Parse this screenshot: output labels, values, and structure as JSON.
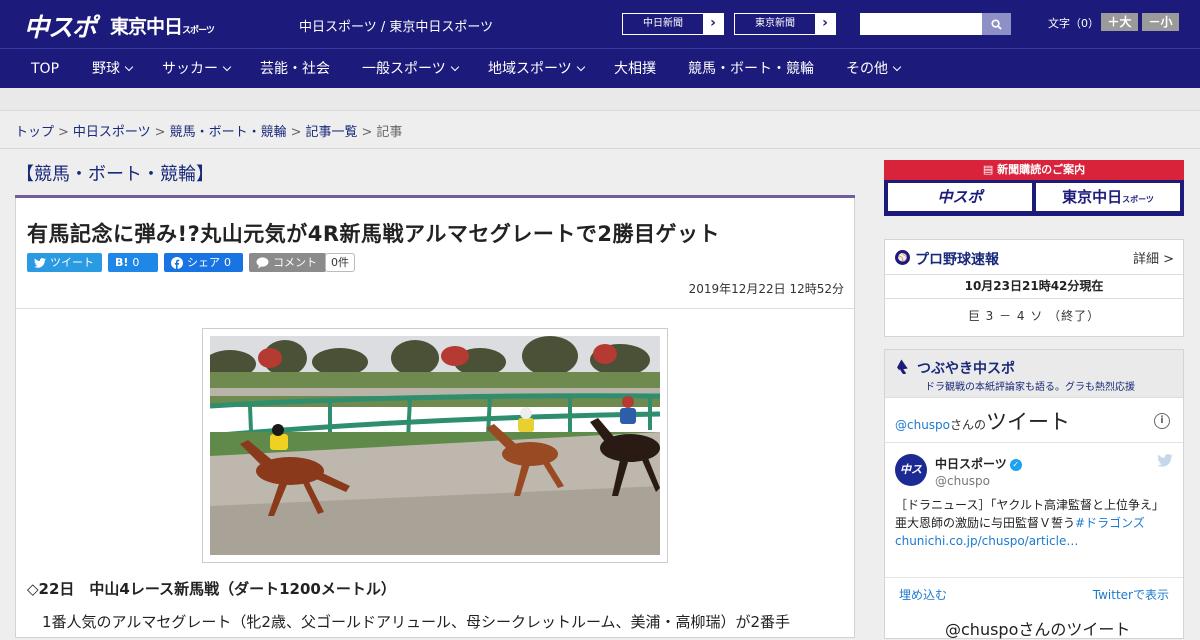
{
  "header": {
    "logo_main": "中スポ",
    "logo_tokyo": "東京中日",
    "logo_tokyo_suffix": "スポーツ",
    "site_links": "中日スポーツ / 東京中日スポーツ",
    "ext_link_1": "中日新聞",
    "ext_link_2": "東京新聞",
    "search_placeholder": "",
    "font_size_label": "文字（0）",
    "font_larger": "＋大",
    "font_smaller": "－小"
  },
  "nav": [
    {
      "label": "TOP",
      "dropdown": false
    },
    {
      "label": "野球",
      "dropdown": true
    },
    {
      "label": "サッカー",
      "dropdown": true
    },
    {
      "label": "芸能・社会",
      "dropdown": false
    },
    {
      "label": "一般スポーツ",
      "dropdown": true
    },
    {
      "label": "地域スポーツ",
      "dropdown": true
    },
    {
      "label": "大相撲",
      "dropdown": false
    },
    {
      "label": "競馬・ボート・競輪",
      "dropdown": false
    },
    {
      "label": "その他",
      "dropdown": true
    }
  ],
  "breadcrumb": [
    "トップ",
    "中日スポーツ",
    "競馬・ボート・競輪",
    "記事一覧",
    "記事"
  ],
  "article": {
    "section": "【競馬・ボート・競輪】",
    "headline": "有馬記念に弾み!?丸山元気が4R新馬戦アルマセグレートで2勝目ゲット",
    "share": {
      "tweet": "ツイート",
      "hatena": "B!",
      "hatena_count": "0",
      "facebook": "シェア",
      "facebook_count": "0",
      "comment": "コメント",
      "comment_count": "0件"
    },
    "date": "2019年12月22日 12時52分",
    "subhead": "◇22日　中山4レース新馬戦（ダート1200メートル）",
    "body": "1番人気のアルマセグレート（牝2歳、父ゴールドアリュール、母シークレットルーム、美浦・高柳瑞）が2番手"
  },
  "sidebar": {
    "ad_title": "新聞購読のご案内",
    "ad_btn_1": "中スポ",
    "ad_btn_2": "東京中日",
    "ad_btn_2_suffix": "スポーツ",
    "baseball": {
      "title": "プロ野球速報",
      "detail": "詳細 >",
      "as_of": "10月23日21時42分現在",
      "score": "巨 3 － 4 ソ （終了）"
    },
    "tsubuyaki": {
      "title": "つぶやき中スポ",
      "subtitle": "ドラ観戦の本紙評論家も語る。グラも熱烈応援",
      "tw_header_handle": "@chuspo",
      "tw_header_mid": "さんの",
      "tw_header_big": "ツイート",
      "tw_name": "中日スポーツ",
      "tw_handle": "@chuspo",
      "tw_text": "［ドラニュース］「ヤクルト高津監督と上位争え」亜大恩師の激励に与田監督Ｖ誓う",
      "tw_hashtag": "#ドラゴンズ",
      "tw_link": "chunichi.co.jp/chuspo/article…",
      "tw_embed": "埋め込む",
      "tw_view": "Twitterで表示",
      "tw_more": "@chuspoさんのツイート"
    }
  },
  "colors": {
    "brand_navy": "#1c1a7a",
    "section_rule": "#6f5d9c",
    "ad_red": "#d9233b",
    "twitter_blue": "#2a9ae2",
    "facebook_blue": "#1874e3"
  }
}
